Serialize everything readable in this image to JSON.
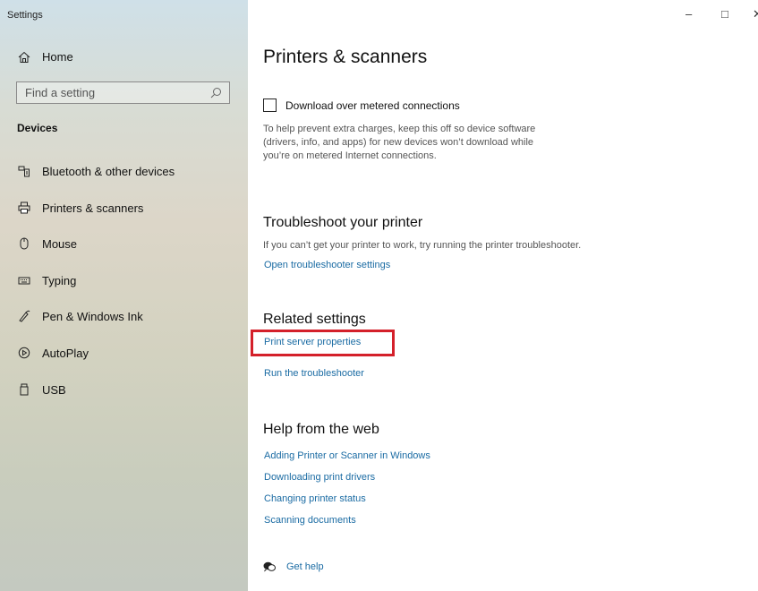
{
  "window": {
    "title": "Settings",
    "minimize_glyph": "–",
    "maximize_glyph": "□",
    "close_glyph": "✕"
  },
  "sidebar": {
    "home_label": "Home",
    "search_placeholder": "Find a setting",
    "section_title": "Devices",
    "items": [
      {
        "label": "Bluetooth & other devices",
        "icon": "bluetooth-devices-icon"
      },
      {
        "label": "Printers & scanners",
        "icon": "printer-icon"
      },
      {
        "label": "Mouse",
        "icon": "mouse-icon"
      },
      {
        "label": "Typing",
        "icon": "keyboard-icon"
      },
      {
        "label": "Pen & Windows Ink",
        "icon": "pen-icon"
      },
      {
        "label": "AutoPlay",
        "icon": "autoplay-icon"
      },
      {
        "label": "USB",
        "icon": "usb-icon"
      }
    ]
  },
  "main": {
    "title": "Printers & scanners",
    "metered": {
      "label": "Download over metered connections",
      "checked": false,
      "description_lines": [
        "To help prevent extra charges, keep this off so device software",
        "(drivers, info, and apps) for new devices won’t download while",
        "you’re on metered Internet connections."
      ]
    },
    "troubleshoot": {
      "heading": "Troubleshoot your printer",
      "text": "If you can’t get your printer to work, try running the printer troubleshooter.",
      "link": "Open troubleshooter settings"
    },
    "related": {
      "heading": "Related settings",
      "links": [
        "Print server properties",
        "Run the troubleshooter"
      ]
    },
    "help_web": {
      "heading": "Help from the web",
      "links": [
        "Adding Printer or Scanner in Windows",
        "Downloading print drivers",
        "Changing printer status",
        "Scanning documents"
      ]
    },
    "get_help": "Get help"
  },
  "colors": {
    "link": "#1a6ba3",
    "highlight": "#d4202a"
  }
}
